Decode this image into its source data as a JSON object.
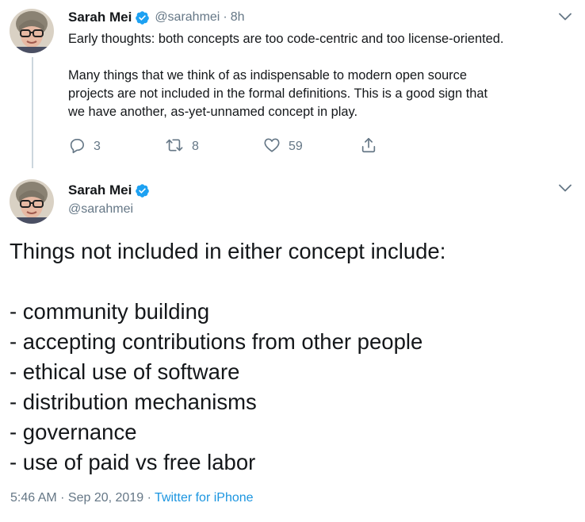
{
  "tweet1": {
    "author_name": "Sarah Mei",
    "author_handle": "@sarahmei",
    "separator": "·",
    "time_ago": "8h",
    "text_lines_para1": [
      "Early thoughts: both concepts are too code-centric and too license-oriented."
    ],
    "text_lines_para2": [
      "Many things that we think of as indispensable to modern open source",
      "projects are not included in the formal definitions. This is a good sign that",
      "we have another, as-yet-unnamed concept in play."
    ],
    "replies": "3",
    "retweets": "8",
    "likes": "59"
  },
  "tweet2": {
    "author_name": "Sarah Mei",
    "author_handle": "@sarahmei",
    "intro": "Things not included in either concept include:",
    "list_items": [
      "- community building",
      "- accepting contributions from other people",
      "- ethical use of software",
      "- distribution mechanisms",
      "- governance",
      "- use of paid vs free labor"
    ],
    "timestamp": "5:46 AM · Sep 20, 2019 · ",
    "source": "Twitter for iPhone"
  },
  "icons": {
    "verified": "verified-badge-icon",
    "caret": "chevron-down-icon",
    "reply": "reply-icon",
    "retweet": "retweet-icon",
    "like": "heart-icon",
    "share": "share-icon"
  },
  "colors": {
    "text": "#14171a",
    "secondary": "#657786",
    "link": "#1b95e0",
    "verified": "#1da1f2",
    "thread_line": "#ccd6dd"
  }
}
